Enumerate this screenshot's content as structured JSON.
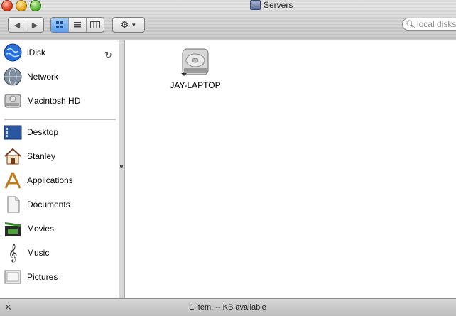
{
  "window": {
    "title": "Servers"
  },
  "toolbar": {
    "back_icon": "back-arrow-icon",
    "forward_icon": "forward-arrow-icon",
    "views": [
      {
        "name": "icon-view",
        "active": true
      },
      {
        "name": "list-view",
        "active": false
      },
      {
        "name": "column-view",
        "active": false
      }
    ],
    "action_icon": "gear-icon",
    "search_placeholder": "local disks"
  },
  "sidebar": {
    "devices": [
      {
        "label": "iDisk",
        "icon": "idisk-globe-icon",
        "sync_icon": "sync-icon"
      },
      {
        "label": "Network",
        "icon": "network-globe-icon"
      },
      {
        "label": "Macintosh HD",
        "icon": "hard-drive-icon"
      }
    ],
    "places": [
      {
        "label": "Desktop",
        "icon": "desktop-icon"
      },
      {
        "label": "Stanley",
        "icon": "home-icon"
      },
      {
        "label": "Applications",
        "icon": "applications-icon"
      },
      {
        "label": "Documents",
        "icon": "documents-icon"
      },
      {
        "label": "Movies",
        "icon": "movies-icon"
      },
      {
        "label": "Music",
        "icon": "music-icon"
      },
      {
        "label": "Pictures",
        "icon": "pictures-icon"
      }
    ]
  },
  "content": {
    "items": [
      {
        "label": "JAY-LAPTOP",
        "icon": "server-disk-icon"
      }
    ]
  },
  "status": {
    "text": "1 item, -- KB available",
    "tool_icon": "tools-icon"
  },
  "colors": {
    "selected_view": "#5d9ee8",
    "window_bg": "#cfcfcf"
  }
}
